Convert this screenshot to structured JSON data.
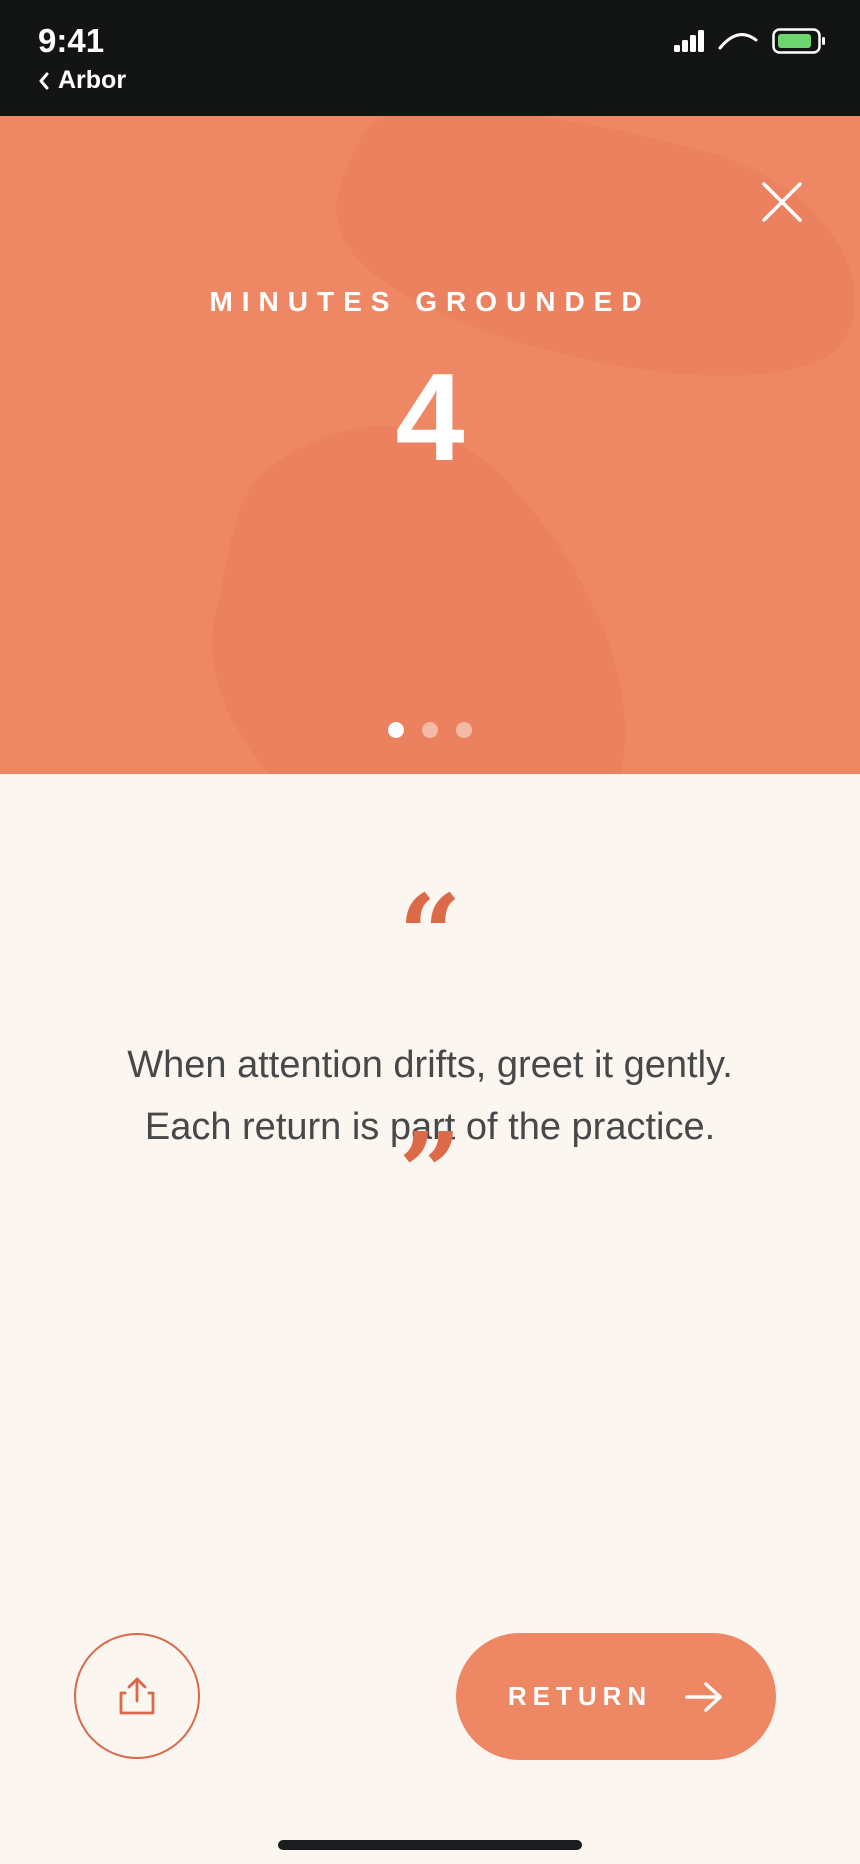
{
  "status_bar": {
    "time": "9:41",
    "back_label": "Arbor",
    "icons": [
      "cellular-signal",
      "wifi",
      "battery"
    ],
    "battery_color": "#6ed66e"
  },
  "summary": {
    "stat_label": "MINUTES GROUNDED",
    "stat_value": "4",
    "pager": {
      "total": 3,
      "active_index": 0
    },
    "close_icon": "close-icon"
  },
  "quote": {
    "open_mark": "“",
    "text": "When attention drifts, greet it gently. Each return is part of the practice.",
    "close_mark": "”"
  },
  "actions": {
    "share_icon": "share-icon",
    "return_label": "RETURN",
    "return_icon": "arrow-right-icon"
  },
  "colors": {
    "accent": "#ee8764",
    "accent_dark": "#dc6a48",
    "background": "#fcf6f0",
    "text": "#474849"
  }
}
